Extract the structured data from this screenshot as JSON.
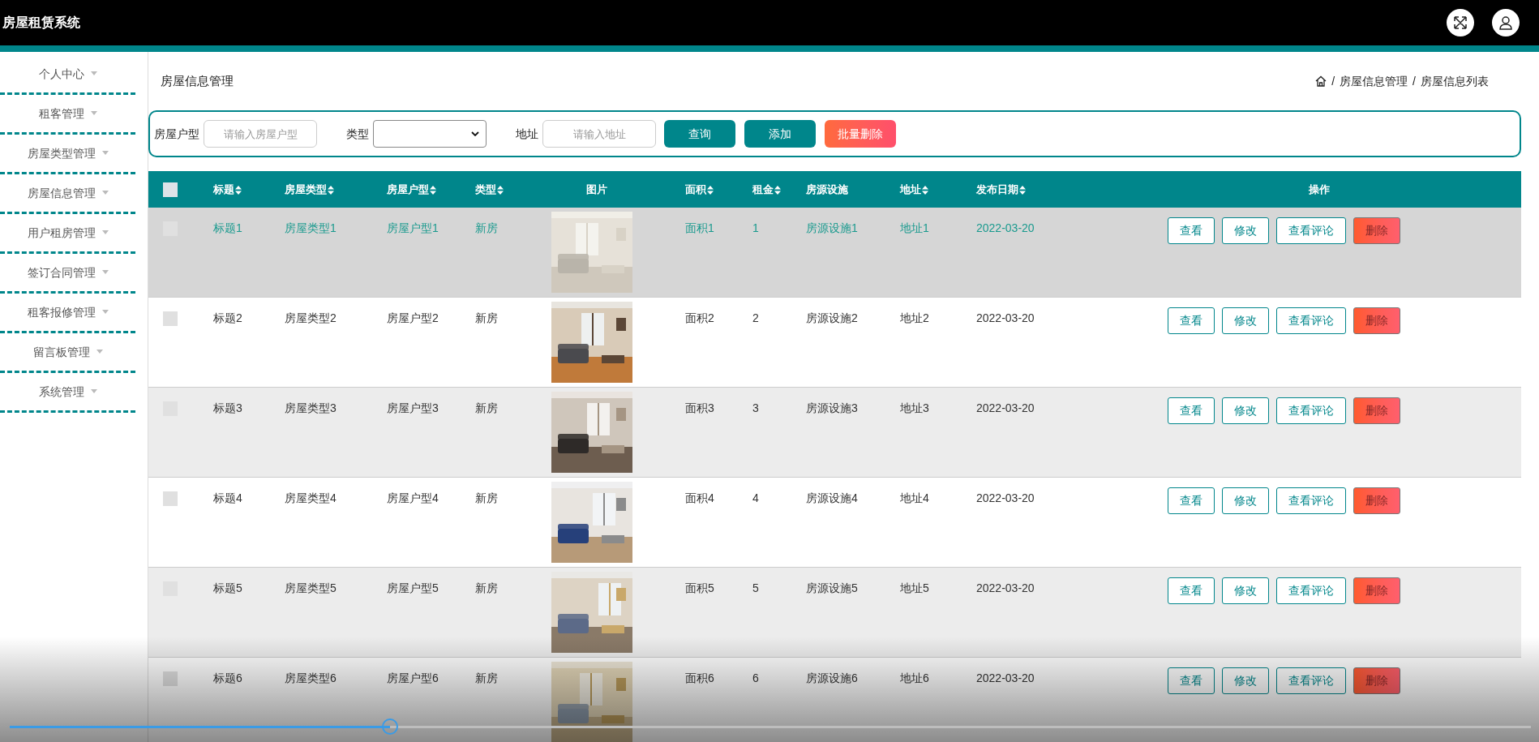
{
  "header": {
    "title": "房屋租赁系统"
  },
  "sidebar": {
    "items": [
      {
        "label": "个人中心"
      },
      {
        "label": "租客管理"
      },
      {
        "label": "房屋类型管理"
      },
      {
        "label": "房屋信息管理"
      },
      {
        "label": "用户租房管理"
      },
      {
        "label": "签订合同管理"
      },
      {
        "label": "租客报修管理"
      },
      {
        "label": "留言板管理"
      },
      {
        "label": "系统管理"
      }
    ]
  },
  "page_title": "房屋信息管理",
  "breadcrumb": [
    {
      "separator": "/",
      "text": "房屋信息管理"
    },
    {
      "separator": "/",
      "text": "房屋信息列表"
    }
  ],
  "search": {
    "fields": [
      {
        "kind": "text",
        "label": "房屋户型",
        "placeholder": "请输入房屋户型"
      },
      {
        "kind": "select",
        "label": "类型"
      },
      {
        "kind": "text",
        "label": "地址",
        "placeholder": "请输入地址"
      }
    ],
    "buttons": [
      {
        "kind": "primary",
        "label": "查询"
      },
      {
        "kind": "primary",
        "label": "添加"
      },
      {
        "kind": "danger",
        "label": "批量删除"
      }
    ]
  },
  "table": {
    "header_checked": false,
    "columns": [
      {
        "label": "标题",
        "sortable": true
      },
      {
        "label": "房屋类型",
        "sortable": true
      },
      {
        "label": "房屋户型",
        "sortable": true
      },
      {
        "label": "类型",
        "sortable": true
      },
      {
        "label": "图片",
        "sortable": false
      },
      {
        "label": "面积",
        "sortable": true
      },
      {
        "label": "租金",
        "sortable": true
      },
      {
        "label": "房源设施",
        "sortable": false
      },
      {
        "label": "地址",
        "sortable": true
      },
      {
        "label": "发布日期",
        "sortable": true
      },
      {
        "label": "操作",
        "sortable": false
      }
    ],
    "rows": [
      {
        "checked": false,
        "highlighted": true,
        "title": "标题1",
        "house_type": "房屋类型1",
        "layout": "房屋户型1",
        "type": "新房",
        "area": "面积1",
        "rent": "1",
        "facilities": "房源设施1",
        "address": "地址1",
        "date": "2022-03-20",
        "actions": [
          {
            "kind": "outline",
            "label": "查看"
          },
          {
            "kind": "outline",
            "label": "修改"
          },
          {
            "kind": "outline",
            "label": "查看评论"
          },
          {
            "kind": "danger",
            "label": "删除"
          }
        ]
      },
      {
        "checked": false,
        "highlighted": false,
        "title": "标题2",
        "house_type": "房屋类型2",
        "layout": "房屋户型2",
        "type": "新房",
        "area": "面积2",
        "rent": "2",
        "facilities": "房源设施2",
        "address": "地址2",
        "date": "2022-03-20",
        "actions": [
          {
            "kind": "outline",
            "label": "查看"
          },
          {
            "kind": "outline",
            "label": "修改"
          },
          {
            "kind": "outline",
            "label": "查看评论"
          },
          {
            "kind": "danger",
            "label": "删除"
          }
        ]
      },
      {
        "checked": false,
        "highlighted": false,
        "title": "标题3",
        "house_type": "房屋类型3",
        "layout": "房屋户型3",
        "type": "新房",
        "area": "面积3",
        "rent": "3",
        "facilities": "房源设施3",
        "address": "地址3",
        "date": "2022-03-20",
        "actions": [
          {
            "kind": "outline",
            "label": "查看"
          },
          {
            "kind": "outline",
            "label": "修改"
          },
          {
            "kind": "outline",
            "label": "查看评论"
          },
          {
            "kind": "danger",
            "label": "删除"
          }
        ]
      },
      {
        "checked": false,
        "highlighted": false,
        "title": "标题4",
        "house_type": "房屋类型4",
        "layout": "房屋户型4",
        "type": "新房",
        "area": "面积4",
        "rent": "4",
        "facilities": "房源设施4",
        "address": "地址4",
        "date": "2022-03-20",
        "actions": [
          {
            "kind": "outline",
            "label": "查看"
          },
          {
            "kind": "outline",
            "label": "修改"
          },
          {
            "kind": "outline",
            "label": "查看评论"
          },
          {
            "kind": "danger",
            "label": "删除"
          }
        ]
      },
      {
        "checked": false,
        "highlighted": false,
        "title": "标题5",
        "house_type": "房屋类型5",
        "layout": "房屋户型5",
        "type": "新房",
        "area": "面积5",
        "rent": "5",
        "facilities": "房源设施5",
        "address": "地址5",
        "date": "2022-03-20",
        "actions": [
          {
            "kind": "outline",
            "label": "查看"
          },
          {
            "kind": "outline",
            "label": "修改"
          },
          {
            "kind": "outline",
            "label": "查看评论"
          },
          {
            "kind": "danger",
            "label": "删除"
          }
        ]
      },
      {
        "checked": false,
        "highlighted": false,
        "title": "标题6",
        "house_type": "房屋类型6",
        "layout": "房屋户型6",
        "type": "新房",
        "area": "面积6",
        "rent": "6",
        "facilities": "房源设施6",
        "address": "地址6",
        "date": "2022-03-20",
        "actions": [
          {
            "kind": "outline",
            "label": "查看"
          },
          {
            "kind": "outline",
            "label": "修改"
          },
          {
            "kind": "outline",
            "label": "查看评论"
          },
          {
            "kind": "danger",
            "label": "删除"
          }
        ]
      }
    ]
  },
  "video_player": {
    "progress": {
      "level": 0.25
    }
  }
}
